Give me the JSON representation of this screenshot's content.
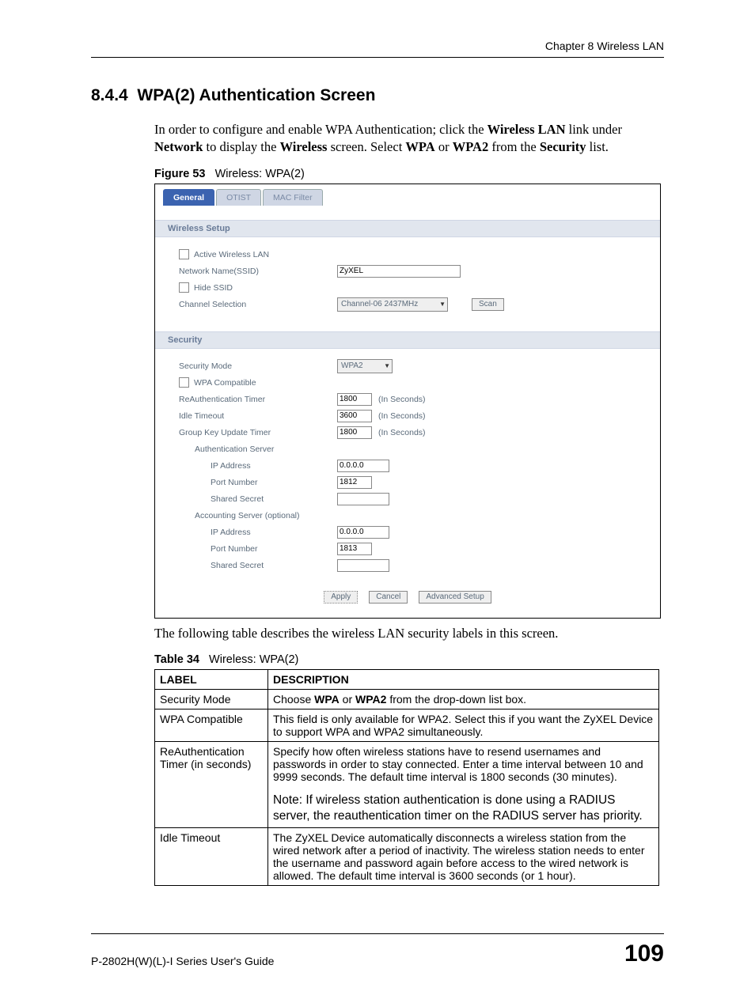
{
  "running_header": "Chapter 8 Wireless LAN",
  "section": {
    "number": "8.4.4",
    "title": "WPA(2) Authentication Screen"
  },
  "intro": {
    "pre": "In order to configure and enable WPA Authentication; click the ",
    "link1": "Wireless LAN",
    "mid1": " link under ",
    "bold_network": "Network",
    "mid2": " to display the ",
    "bold_wireless": "Wireless",
    "mid3": " screen. Select ",
    "bold_wpa": "WPA",
    "mid4": " or ",
    "bold_wpa2": "WPA2",
    "mid5": " from the ",
    "bold_security": "Security",
    "post": " list."
  },
  "figure": {
    "label": "Figure 53",
    "caption": "Wireless: WPA(2)",
    "tabs": {
      "general": "General",
      "otist": "OTIST",
      "mac": "MAC Filter"
    },
    "sections": {
      "wireless": "Wireless Setup",
      "security": "Security"
    },
    "labels": {
      "active_wlan": "Active Wireless LAN",
      "ssid": "Network Name(SSID)",
      "hide_ssid": "Hide SSID",
      "channel": "Channel Selection",
      "scan": "Scan",
      "sec_mode": "Security Mode",
      "wpa_compat": "WPA Compatible",
      "reauth": "ReAuthentication Timer",
      "idle": "Idle Timeout",
      "gku": "Group Key Update Timer",
      "seconds": "(In Seconds)",
      "auth_server": "Authentication Server",
      "acct_server": "Accounting Server (optional)",
      "ip": "IP Address",
      "port": "Port Number",
      "secret": "Shared Secret"
    },
    "values": {
      "ssid": "ZyXEL",
      "channel": "Channel-06 2437MHz",
      "sec_mode": "WPA2",
      "reauth": "1800",
      "idle": "3600",
      "gku": "1800",
      "auth_ip": "0.0.0.0",
      "auth_port": "1812",
      "acct_ip": "0.0.0.0",
      "acct_port": "1813"
    },
    "buttons": {
      "apply": "Apply",
      "cancel": "Cancel",
      "advanced": "Advanced Setup"
    }
  },
  "post_figure": "The following table describes the wireless LAN security labels in this screen.",
  "table": {
    "label": "Table 34",
    "caption": "Wireless: WPA(2)",
    "headers": {
      "label": "LABEL",
      "desc": "DESCRIPTION"
    },
    "rows": [
      {
        "label": "Security Mode",
        "desc_pre": "Choose ",
        "desc_b1": "WPA",
        "desc_mid": " or ",
        "desc_b2": "WPA2",
        "desc_post": " from the drop-down list box."
      },
      {
        "label": "WPA Compatible",
        "desc": "This field is only available for WPA2. Select this if you want the ZyXEL Device to support WPA and WPA2 simultaneously."
      },
      {
        "label": "ReAuthentication Timer (in seconds)",
        "desc": "Specify how often wireless stations have to resend usernames and passwords in order to stay connected. Enter a time interval between 10 and 9999 seconds. The default time interval is 1800 seconds (30 minutes).",
        "note": "Note: If wireless station authentication is done using a RADIUS server, the reauthentication timer on the RADIUS server has priority."
      },
      {
        "label": "Idle Timeout",
        "desc": "The ZyXEL Device automatically disconnects a wireless station from the wired network after a period of inactivity. The wireless station needs to enter the username and password again before access to the wired network is allowed. The default time interval is 3600 seconds (or 1 hour)."
      }
    ]
  },
  "footer": {
    "guide": "P-2802H(W)(L)-I Series User's Guide",
    "page": "109"
  }
}
